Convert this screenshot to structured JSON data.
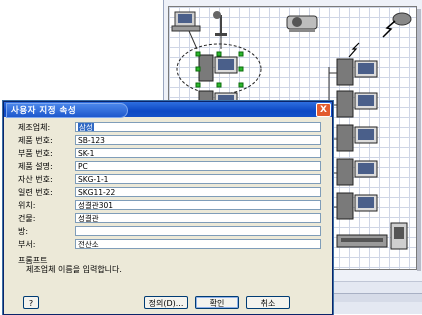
{
  "dialog": {
    "title": "사용자 지정 속성",
    "close_label": "X",
    "fields": [
      {
        "label": "제조업체:",
        "value": "삼성"
      },
      {
        "label": "제품 번호:",
        "value": "SB-123"
      },
      {
        "label": "부품 번호:",
        "value": "SK-1"
      },
      {
        "label": "제품 설명:",
        "value": "PC"
      },
      {
        "label": "자산 번호:",
        "value": "SKG-1-1"
      },
      {
        "label": "일련 번호:",
        "value": "SKG11-22"
      },
      {
        "label": "위치:",
        "value": "성결관301"
      },
      {
        "label": "건물:",
        "value": "성결관"
      },
      {
        "label": "방:",
        "value": ""
      },
      {
        "label": "부서:",
        "value": "전산소"
      }
    ],
    "prompt_title": "프롬프트",
    "prompt_text": "제조업체 이름을 입력합니다.",
    "help_label": "?",
    "define_label": "정의(D)...",
    "ok_label": "확인",
    "cancel_label": "취소"
  },
  "colors": {
    "titlebar": "#0c48c4",
    "dialog_bg": "#ece9d8",
    "selection": "#316ac5"
  }
}
